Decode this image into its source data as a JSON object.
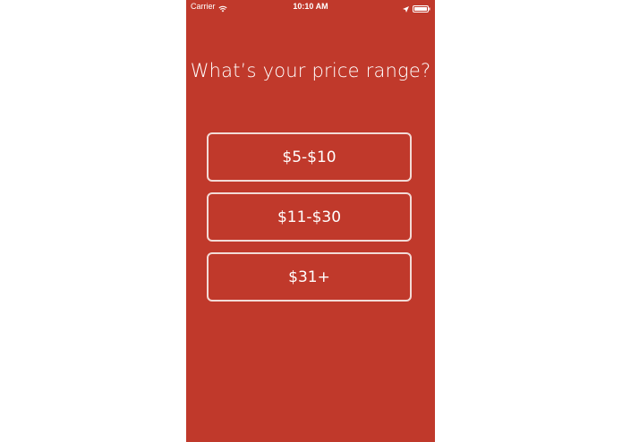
{
  "status_bar": {
    "carrier": "Carrier",
    "time": "10:10 AM",
    "icons": [
      "wifi-icon",
      "location-icon",
      "battery-icon"
    ]
  },
  "question": "What’s your price range?",
  "options": [
    {
      "label": "$5-$10"
    },
    {
      "label": "$11-$30"
    },
    {
      "label": "$31+"
    }
  ],
  "colors": {
    "background": "#c0392b",
    "text": "#ffffff",
    "button_border": "#f3dad6"
  }
}
